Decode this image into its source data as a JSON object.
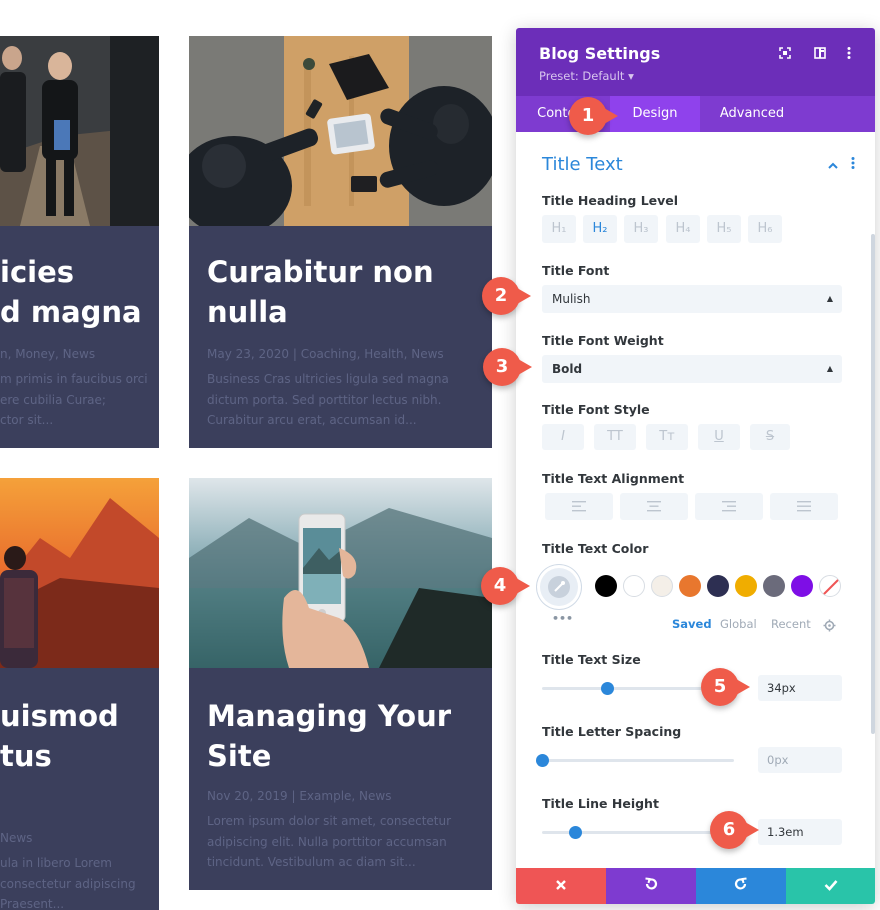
{
  "cards": [
    {
      "title_lines": [
        "icies",
        "d magna"
      ],
      "meta": "n, Money, News",
      "excerpt_lines": [
        "m primis in faucibus orci",
        "ere cubilia Curae;",
        "ctor sit..."
      ]
    },
    {
      "title_lines": [
        "Curabitur non",
        "nulla"
      ],
      "meta": "May 23, 2020 | Coaching, Health, News",
      "excerpt_lines": [
        "Business Cras ultricies ligula sed magna",
        "dictum porta. Sed porttitor lectus nibh.",
        "Curabitur arcu erat, accumsan id..."
      ]
    },
    {
      "title_lines": [
        "uismod",
        "tus"
      ],
      "meta": " News",
      "excerpt_lines": [
        "ula in libero Lorem",
        "consectetur adipiscing",
        "Praesent..."
      ]
    },
    {
      "title_lines": [
        "Managing Your",
        "Site"
      ],
      "meta": "Nov 20, 2019 | Example, News",
      "excerpt_lines": [
        "Lorem ipsum dolor sit amet, consectetur",
        "adipiscing elit. Nulla porttitor accumsan",
        "tincidunt. Vestibulum ac diam sit..."
      ]
    }
  ],
  "panel": {
    "title": "Blog Settings",
    "preset": "Preset: Default ▾",
    "header_icons": [
      "focus-icon",
      "split-view-icon",
      "more-vertical-icon"
    ],
    "tabs": [
      "Content",
      "Design",
      "Advanced"
    ],
    "active_tab": "Design",
    "section_title": "Title Text",
    "labels": {
      "heading_level": "Title Heading Level",
      "font": "Title Font",
      "font_weight": "Title Font Weight",
      "font_style": "Title Font Style",
      "alignment": "Title Text Alignment",
      "color": "Title Text Color",
      "size": "Title Text Size",
      "letter_spacing": "Title Letter Spacing",
      "line_height": "Title Line Height"
    },
    "heading_levels": [
      "H₁",
      "H₂",
      "H₃",
      "H₄",
      "H₅",
      "H₆"
    ],
    "selected_heading": "H₂",
    "font_value": "Mulish",
    "font_weight_value": "Bold",
    "font_styles": [
      "I",
      "TT",
      "Tт",
      "U",
      "S"
    ],
    "alignment_options": [
      "left",
      "center",
      "right",
      "justify"
    ],
    "color_swatches": [
      "#000000",
      "#ffffff",
      "#f4efe8",
      "#e8772e",
      "#2d2f52",
      "#f0ad00",
      "#6b6b7b",
      "#7e0ee6"
    ],
    "color_more": "•••",
    "color_tabs": [
      "Saved",
      "Global",
      "Recent"
    ],
    "size_value": "34px",
    "size_slider": 0.34,
    "letter_spacing_value": "0px",
    "letter_spacing_slider": 0,
    "line_height_value": "1.3em",
    "line_height_slider": 0.17,
    "footer_buttons": [
      "cancel",
      "undo",
      "redo",
      "save"
    ],
    "footer_colors": [
      "#ef5555",
      "#7e3bd0",
      "#2b87da",
      "#29c4a9"
    ]
  },
  "badges": [
    "1",
    "2",
    "3",
    "4",
    "5",
    "6"
  ],
  "colors": {
    "accent": "#2b87da",
    "header": "#6c2eb9",
    "card_bg": "#3b3f5c",
    "badge": "#ef5b4a"
  }
}
